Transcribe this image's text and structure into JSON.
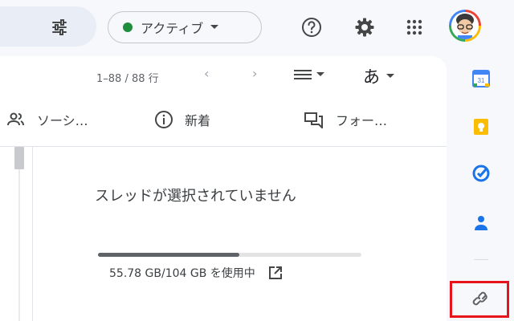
{
  "topbar": {
    "status_label": "アクティブ",
    "status_color": "#1e8e3e",
    "icons": [
      "filter-icon",
      "help-icon",
      "settings-icon",
      "apps-grid-icon",
      "avatar"
    ]
  },
  "toolbar": {
    "pagination": "1–88 / 88 行",
    "prev_icon": "‹",
    "next_icon": "›",
    "input_tool_label": "あ"
  },
  "tabs": [
    {
      "label": "ソーシ…",
      "icon": "people-icon"
    },
    {
      "label": "新着",
      "icon": "info-icon"
    },
    {
      "label": "フォー…",
      "icon": "forum-icon"
    }
  ],
  "reading_pane": {
    "empty_message": "スレッドが選択されていません"
  },
  "storage": {
    "text": "55.78 GB/104 GB を使用中",
    "used_fraction": 0.536
  },
  "side_panel": {
    "apps": [
      "calendar-icon",
      "keep-icon",
      "tasks-icon",
      "contacts-icon",
      "add-ons-link-icon"
    ],
    "calendar_day": "31",
    "highlight_color": "#e8141b"
  }
}
